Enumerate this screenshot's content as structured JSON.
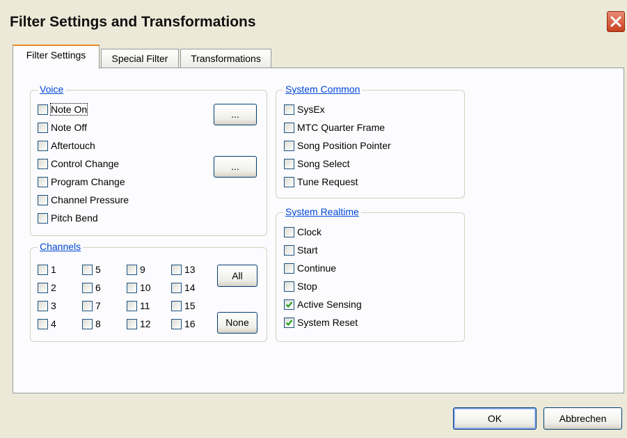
{
  "window": {
    "title": "Filter Settings and Transformations"
  },
  "tabs": [
    {
      "label": "Filter Settings",
      "active": true
    },
    {
      "label": "Special Filter",
      "active": false
    },
    {
      "label": "Transformations",
      "active": false
    }
  ],
  "voice": {
    "title": "Voice",
    "items": [
      {
        "label": "Note On",
        "checked": false
      },
      {
        "label": "Note Off",
        "checked": false
      },
      {
        "label": "Aftertouch",
        "checked": false
      },
      {
        "label": "Control Change",
        "checked": false
      },
      {
        "label": "Program Change",
        "checked": false
      },
      {
        "label": "Channel Pressure",
        "checked": false
      },
      {
        "label": "Pitch Bend",
        "checked": false
      }
    ],
    "more_button_1": "...",
    "more_button_2": "..."
  },
  "channels": {
    "title": "Channels",
    "items": [
      "1",
      "2",
      "3",
      "4",
      "5",
      "6",
      "7",
      "8",
      "9",
      "10",
      "11",
      "12",
      "13",
      "14",
      "15",
      "16"
    ],
    "all_button": "All",
    "none_button": "None"
  },
  "system_common": {
    "title": "System Common",
    "items": [
      {
        "label": "SysEx",
        "checked": false
      },
      {
        "label": "MTC Quarter Frame",
        "checked": false
      },
      {
        "label": "Song Position Pointer",
        "checked": false
      },
      {
        "label": "Song Select",
        "checked": false
      },
      {
        "label": "Tune Request",
        "checked": false
      }
    ]
  },
  "system_realtime": {
    "title": "System Realtime",
    "items": [
      {
        "label": "Clock",
        "checked": false
      },
      {
        "label": "Start",
        "checked": false
      },
      {
        "label": "Continue",
        "checked": false
      },
      {
        "label": "Stop",
        "checked": false
      },
      {
        "label": "Active Sensing",
        "checked": true
      },
      {
        "label": "System Reset",
        "checked": true
      }
    ]
  },
  "footer": {
    "ok": "OK",
    "cancel": "Abbrechen"
  },
  "colors": {
    "accent": "#0046d5",
    "tab_highlight": "#e68b2c",
    "check": "#21a121",
    "dialog_bg": "#ECE9D8"
  },
  "icons": {
    "close": "close-icon",
    "check": "checkmark-icon"
  }
}
